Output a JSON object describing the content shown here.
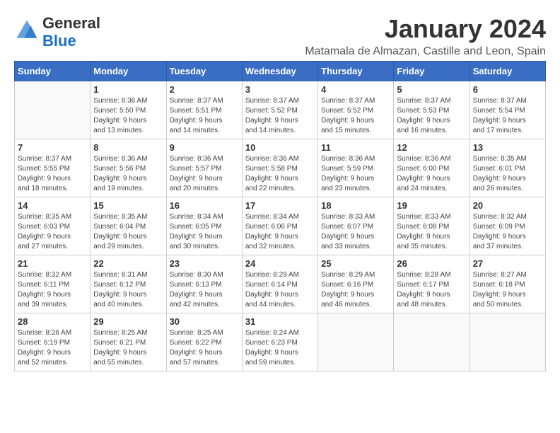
{
  "header": {
    "logo_line1": "General",
    "logo_line2": "Blue",
    "title": "January 2024",
    "subtitle": "Matamala de Almazan, Castille and Leon, Spain"
  },
  "calendar": {
    "days_of_week": [
      "Sunday",
      "Monday",
      "Tuesday",
      "Wednesday",
      "Thursday",
      "Friday",
      "Saturday"
    ],
    "weeks": [
      [
        {
          "day": "",
          "info": ""
        },
        {
          "day": "1",
          "info": "Sunrise: 8:36 AM\nSunset: 5:50 PM\nDaylight: 9 hours\nand 13 minutes."
        },
        {
          "day": "2",
          "info": "Sunrise: 8:37 AM\nSunset: 5:51 PM\nDaylight: 9 hours\nand 14 minutes."
        },
        {
          "day": "3",
          "info": "Sunrise: 8:37 AM\nSunset: 5:52 PM\nDaylight: 9 hours\nand 14 minutes."
        },
        {
          "day": "4",
          "info": "Sunrise: 8:37 AM\nSunset: 5:52 PM\nDaylight: 9 hours\nand 15 minutes."
        },
        {
          "day": "5",
          "info": "Sunrise: 8:37 AM\nSunset: 5:53 PM\nDaylight: 9 hours\nand 16 minutes."
        },
        {
          "day": "6",
          "info": "Sunrise: 8:37 AM\nSunset: 5:54 PM\nDaylight: 9 hours\nand 17 minutes."
        }
      ],
      [
        {
          "day": "7",
          "info": "Sunrise: 8:37 AM\nSunset: 5:55 PM\nDaylight: 9 hours\nand 18 minutes."
        },
        {
          "day": "8",
          "info": "Sunrise: 8:36 AM\nSunset: 5:56 PM\nDaylight: 9 hours\nand 19 minutes."
        },
        {
          "day": "9",
          "info": "Sunrise: 8:36 AM\nSunset: 5:57 PM\nDaylight: 9 hours\nand 20 minutes."
        },
        {
          "day": "10",
          "info": "Sunrise: 8:36 AM\nSunset: 5:58 PM\nDaylight: 9 hours\nand 22 minutes."
        },
        {
          "day": "11",
          "info": "Sunrise: 8:36 AM\nSunset: 5:59 PM\nDaylight: 9 hours\nand 23 minutes."
        },
        {
          "day": "12",
          "info": "Sunrise: 8:36 AM\nSunset: 6:00 PM\nDaylight: 9 hours\nand 24 minutes."
        },
        {
          "day": "13",
          "info": "Sunrise: 8:35 AM\nSunset: 6:01 PM\nDaylight: 9 hours\nand 26 minutes."
        }
      ],
      [
        {
          "day": "14",
          "info": "Sunrise: 8:35 AM\nSunset: 6:03 PM\nDaylight: 9 hours\nand 27 minutes."
        },
        {
          "day": "15",
          "info": "Sunrise: 8:35 AM\nSunset: 6:04 PM\nDaylight: 9 hours\nand 29 minutes."
        },
        {
          "day": "16",
          "info": "Sunrise: 8:34 AM\nSunset: 6:05 PM\nDaylight: 9 hours\nand 30 minutes."
        },
        {
          "day": "17",
          "info": "Sunrise: 8:34 AM\nSunset: 6:06 PM\nDaylight: 9 hours\nand 32 minutes."
        },
        {
          "day": "18",
          "info": "Sunrise: 8:33 AM\nSunset: 6:07 PM\nDaylight: 9 hours\nand 33 minutes."
        },
        {
          "day": "19",
          "info": "Sunrise: 8:33 AM\nSunset: 6:08 PM\nDaylight: 9 hours\nand 35 minutes."
        },
        {
          "day": "20",
          "info": "Sunrise: 8:32 AM\nSunset: 6:09 PM\nDaylight: 9 hours\nand 37 minutes."
        }
      ],
      [
        {
          "day": "21",
          "info": "Sunrise: 8:32 AM\nSunset: 6:11 PM\nDaylight: 9 hours\nand 39 minutes."
        },
        {
          "day": "22",
          "info": "Sunrise: 8:31 AM\nSunset: 6:12 PM\nDaylight: 9 hours\nand 40 minutes."
        },
        {
          "day": "23",
          "info": "Sunrise: 8:30 AM\nSunset: 6:13 PM\nDaylight: 9 hours\nand 42 minutes."
        },
        {
          "day": "24",
          "info": "Sunrise: 8:29 AM\nSunset: 6:14 PM\nDaylight: 9 hours\nand 44 minutes."
        },
        {
          "day": "25",
          "info": "Sunrise: 8:29 AM\nSunset: 6:16 PM\nDaylight: 9 hours\nand 46 minutes."
        },
        {
          "day": "26",
          "info": "Sunrise: 8:28 AM\nSunset: 6:17 PM\nDaylight: 9 hours\nand 48 minutes."
        },
        {
          "day": "27",
          "info": "Sunrise: 8:27 AM\nSunset: 6:18 PM\nDaylight: 9 hours\nand 50 minutes."
        }
      ],
      [
        {
          "day": "28",
          "info": "Sunrise: 8:26 AM\nSunset: 6:19 PM\nDaylight: 9 hours\nand 52 minutes."
        },
        {
          "day": "29",
          "info": "Sunrise: 8:25 AM\nSunset: 6:21 PM\nDaylight: 9 hours\nand 55 minutes."
        },
        {
          "day": "30",
          "info": "Sunrise: 8:25 AM\nSunset: 6:22 PM\nDaylight: 9 hours\nand 57 minutes."
        },
        {
          "day": "31",
          "info": "Sunrise: 8:24 AM\nSunset: 6:23 PM\nDaylight: 9 hours\nand 59 minutes."
        },
        {
          "day": "",
          "info": ""
        },
        {
          "day": "",
          "info": ""
        },
        {
          "day": "",
          "info": ""
        }
      ]
    ]
  }
}
